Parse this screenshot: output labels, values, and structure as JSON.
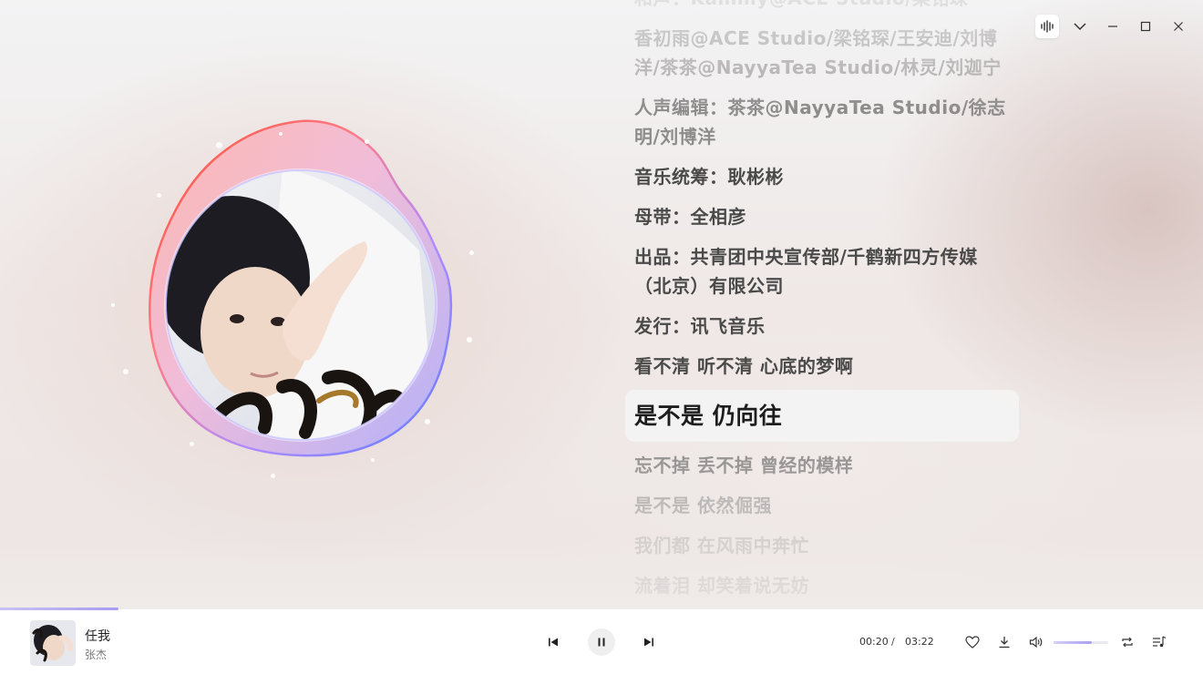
{
  "window": {
    "controls": [
      "audio-wave-icon",
      "chevron-down-icon",
      "minimize-icon",
      "maximize-icon",
      "close-icon"
    ]
  },
  "colors": {
    "accent": "#a79cf1",
    "ring_start": "#ff5a4a",
    "ring_end": "#5a78ff",
    "active_lyric_bg": "#f5f5f5"
  },
  "lyrics": [
    {
      "text": "和声：Kammy@ACE Studio/梁铭琛",
      "state": "fainter"
    },
    {
      "text": "香初雨@ACE Studio/梁铭琛/王安迪/刘博洋/茶茶@NayyaTea Studio/林灵/刘迦宁",
      "state": "faint"
    },
    {
      "text": "人声编辑：茶茶@NayyaTea Studio/徐志明/刘博洋",
      "state": "dim"
    },
    {
      "text": "音乐统筹：耿彬彬",
      "state": "normal"
    },
    {
      "text": "母带：全相彦",
      "state": "normal"
    },
    {
      "text": "出品：共青团中央宣传部/千鹤新四方传媒（北京）有限公司",
      "state": "normal"
    },
    {
      "text": "发行：讯飞音乐",
      "state": "normal"
    },
    {
      "text": "看不清 听不清 心底的梦啊",
      "state": "normal"
    },
    {
      "text": "是不是 仍向往",
      "state": "active"
    },
    {
      "text": "忘不掉 丢不掉 曾经的模样",
      "state": "dim"
    },
    {
      "text": "是不是 依然倔强",
      "state": "faint"
    },
    {
      "text": "我们都 在风雨中奔忙",
      "state": "fainter"
    },
    {
      "text": "流着泪 却笑着说无妨",
      "state": "fainter"
    }
  ],
  "player": {
    "song_title": "任我",
    "artist": "张杰",
    "current_time": "00:20",
    "separator": "/",
    "duration": "03:22",
    "progress": 0.0985,
    "volume": 0.7,
    "is_playing": true
  }
}
